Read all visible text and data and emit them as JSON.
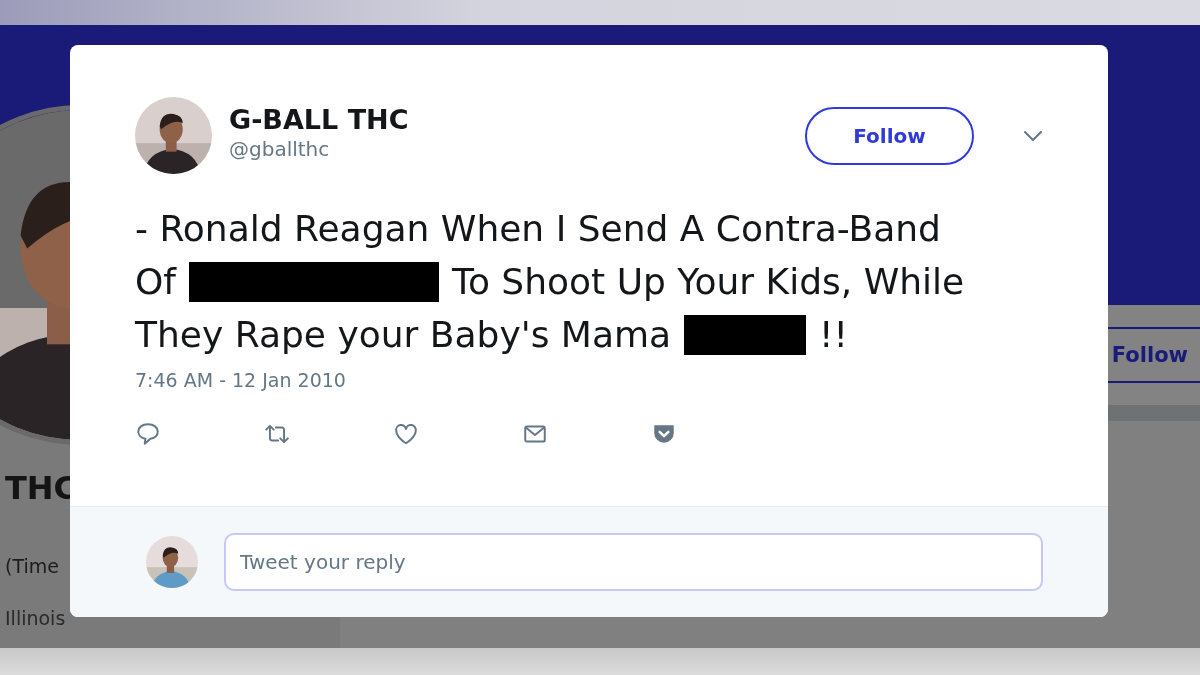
{
  "background_profile": {
    "name": "THC",
    "bio": "(Time",
    "location": "Illinois",
    "follow_button": "Follow"
  },
  "tweet_modal": {
    "display_name": "G-BALL THC",
    "handle": "@gballthc",
    "follow_button": "Follow",
    "text_lines": [
      [
        {
          "kind": "text",
          "text": "- Ronald Reagan When I Send A Contra-Band"
        }
      ],
      [
        {
          "kind": "text",
          "text": "Of"
        },
        {
          "kind": "redaction"
        },
        {
          "kind": "text",
          "text": "To Shoot Up Your Kids, While"
        }
      ],
      [
        {
          "kind": "text",
          "text": "They Rape your Baby's Mama"
        },
        {
          "kind": "redaction"
        },
        {
          "kind": "text",
          "text": "!!"
        }
      ]
    ],
    "timestamp": "7:46 AM - 12 Jan 2010",
    "actions": [
      {
        "kind": "reply"
      },
      {
        "kind": "retweet"
      },
      {
        "kind": "like"
      },
      {
        "kind": "message"
      },
      {
        "kind": "pocket"
      }
    ],
    "reply_field": {
      "placeholder": "Tweet your reply"
    }
  }
}
